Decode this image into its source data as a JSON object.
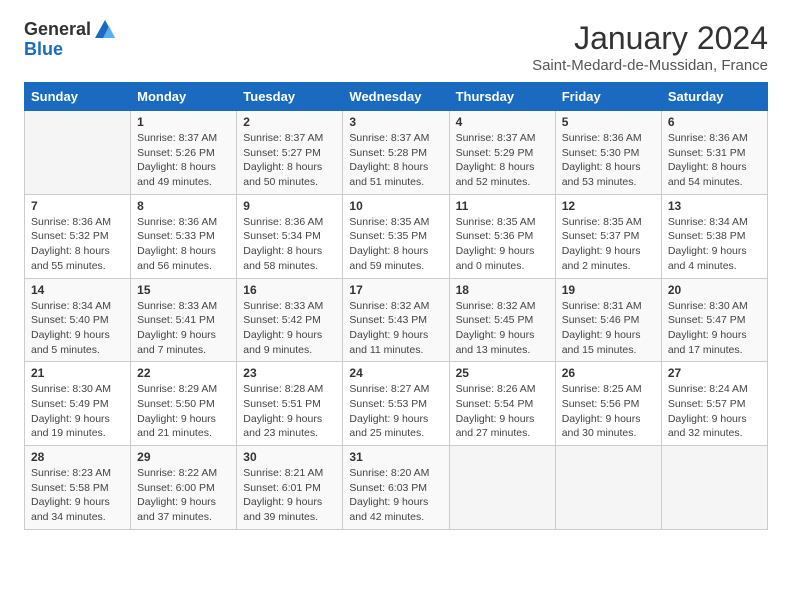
{
  "logo": {
    "general": "General",
    "blue": "Blue"
  },
  "title": "January 2024",
  "subtitle": "Saint-Medard-de-Mussidan, France",
  "days_header": [
    "Sunday",
    "Monday",
    "Tuesday",
    "Wednesday",
    "Thursday",
    "Friday",
    "Saturday"
  ],
  "weeks": [
    [
      {
        "day": "",
        "info": ""
      },
      {
        "day": "1",
        "info": "Sunrise: 8:37 AM\nSunset: 5:26 PM\nDaylight: 8 hours\nand 49 minutes."
      },
      {
        "day": "2",
        "info": "Sunrise: 8:37 AM\nSunset: 5:27 PM\nDaylight: 8 hours\nand 50 minutes."
      },
      {
        "day": "3",
        "info": "Sunrise: 8:37 AM\nSunset: 5:28 PM\nDaylight: 8 hours\nand 51 minutes."
      },
      {
        "day": "4",
        "info": "Sunrise: 8:37 AM\nSunset: 5:29 PM\nDaylight: 8 hours\nand 52 minutes."
      },
      {
        "day": "5",
        "info": "Sunrise: 8:36 AM\nSunset: 5:30 PM\nDaylight: 8 hours\nand 53 minutes."
      },
      {
        "day": "6",
        "info": "Sunrise: 8:36 AM\nSunset: 5:31 PM\nDaylight: 8 hours\nand 54 minutes."
      }
    ],
    [
      {
        "day": "7",
        "info": "Sunrise: 8:36 AM\nSunset: 5:32 PM\nDaylight: 8 hours\nand 55 minutes."
      },
      {
        "day": "8",
        "info": "Sunrise: 8:36 AM\nSunset: 5:33 PM\nDaylight: 8 hours\nand 56 minutes."
      },
      {
        "day": "9",
        "info": "Sunrise: 8:36 AM\nSunset: 5:34 PM\nDaylight: 8 hours\nand 58 minutes."
      },
      {
        "day": "10",
        "info": "Sunrise: 8:35 AM\nSunset: 5:35 PM\nDaylight: 8 hours\nand 59 minutes."
      },
      {
        "day": "11",
        "info": "Sunrise: 8:35 AM\nSunset: 5:36 PM\nDaylight: 9 hours\nand 0 minutes."
      },
      {
        "day": "12",
        "info": "Sunrise: 8:35 AM\nSunset: 5:37 PM\nDaylight: 9 hours\nand 2 minutes."
      },
      {
        "day": "13",
        "info": "Sunrise: 8:34 AM\nSunset: 5:38 PM\nDaylight: 9 hours\nand 4 minutes."
      }
    ],
    [
      {
        "day": "14",
        "info": "Sunrise: 8:34 AM\nSunset: 5:40 PM\nDaylight: 9 hours\nand 5 minutes."
      },
      {
        "day": "15",
        "info": "Sunrise: 8:33 AM\nSunset: 5:41 PM\nDaylight: 9 hours\nand 7 minutes."
      },
      {
        "day": "16",
        "info": "Sunrise: 8:33 AM\nSunset: 5:42 PM\nDaylight: 9 hours\nand 9 minutes."
      },
      {
        "day": "17",
        "info": "Sunrise: 8:32 AM\nSunset: 5:43 PM\nDaylight: 9 hours\nand 11 minutes."
      },
      {
        "day": "18",
        "info": "Sunrise: 8:32 AM\nSunset: 5:45 PM\nDaylight: 9 hours\nand 13 minutes."
      },
      {
        "day": "19",
        "info": "Sunrise: 8:31 AM\nSunset: 5:46 PM\nDaylight: 9 hours\nand 15 minutes."
      },
      {
        "day": "20",
        "info": "Sunrise: 8:30 AM\nSunset: 5:47 PM\nDaylight: 9 hours\nand 17 minutes."
      }
    ],
    [
      {
        "day": "21",
        "info": "Sunrise: 8:30 AM\nSunset: 5:49 PM\nDaylight: 9 hours\nand 19 minutes."
      },
      {
        "day": "22",
        "info": "Sunrise: 8:29 AM\nSunset: 5:50 PM\nDaylight: 9 hours\nand 21 minutes."
      },
      {
        "day": "23",
        "info": "Sunrise: 8:28 AM\nSunset: 5:51 PM\nDaylight: 9 hours\nand 23 minutes."
      },
      {
        "day": "24",
        "info": "Sunrise: 8:27 AM\nSunset: 5:53 PM\nDaylight: 9 hours\nand 25 minutes."
      },
      {
        "day": "25",
        "info": "Sunrise: 8:26 AM\nSunset: 5:54 PM\nDaylight: 9 hours\nand 27 minutes."
      },
      {
        "day": "26",
        "info": "Sunrise: 8:25 AM\nSunset: 5:56 PM\nDaylight: 9 hours\nand 30 minutes."
      },
      {
        "day": "27",
        "info": "Sunrise: 8:24 AM\nSunset: 5:57 PM\nDaylight: 9 hours\nand 32 minutes."
      }
    ],
    [
      {
        "day": "28",
        "info": "Sunrise: 8:23 AM\nSunset: 5:58 PM\nDaylight: 9 hours\nand 34 minutes."
      },
      {
        "day": "29",
        "info": "Sunrise: 8:22 AM\nSunset: 6:00 PM\nDaylight: 9 hours\nand 37 minutes."
      },
      {
        "day": "30",
        "info": "Sunrise: 8:21 AM\nSunset: 6:01 PM\nDaylight: 9 hours\nand 39 minutes."
      },
      {
        "day": "31",
        "info": "Sunrise: 8:20 AM\nSunset: 6:03 PM\nDaylight: 9 hours\nand 42 minutes."
      },
      {
        "day": "",
        "info": ""
      },
      {
        "day": "",
        "info": ""
      },
      {
        "day": "",
        "info": ""
      }
    ]
  ]
}
